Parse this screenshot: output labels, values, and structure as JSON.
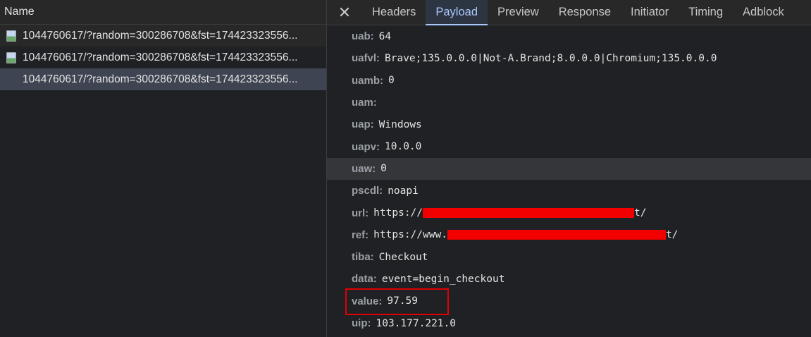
{
  "left_panel": {
    "header": "Name",
    "requests": [
      {
        "name": "1044760617/?random=300286708&fst=174423323556...",
        "icon": "image-file-icon"
      },
      {
        "name": "1044760617/?random=300286708&fst=174423323556...",
        "icon": "image-file-icon"
      },
      {
        "name": "1044760617/?random=300286708&fst=174423323556...",
        "icon": "image-file-icon"
      }
    ]
  },
  "tabs": {
    "close": "✕",
    "items": [
      "Headers",
      "Payload",
      "Preview",
      "Response",
      "Initiator",
      "Timing",
      "Adblock"
    ],
    "active": "Payload"
  },
  "payload": {
    "rows": [
      {
        "key": "uab:",
        "value": "64"
      },
      {
        "key": "uafvl:",
        "value": "Brave;135.0.0.0|Not-A.Brand;8.0.0.0|Chromium;135.0.0.0"
      },
      {
        "key": "uamb:",
        "value": "0"
      },
      {
        "key": "uam:",
        "value": ""
      },
      {
        "key": "uap:",
        "value": "Windows"
      },
      {
        "key": "uapv:",
        "value": "10.0.0"
      },
      {
        "key": "uaw:",
        "value": "0"
      },
      {
        "key": "pscdl:",
        "value": "noapi"
      },
      {
        "key": "url:",
        "value_prefix": "https://",
        "value_suffix": "t/"
      },
      {
        "key": "ref:",
        "value_prefix": "https://www.",
        "value_suffix": "t/"
      },
      {
        "key": "tiba:",
        "value": "Checkout"
      },
      {
        "key": "data:",
        "value": "event=begin_checkout"
      },
      {
        "key": "value:",
        "value": "97.59"
      },
      {
        "key": "uip:",
        "value": "103.177.221.0"
      }
    ]
  },
  "colors": {
    "accent": "#a8c7fa",
    "redaction": "#f20000",
    "annotation_box": "#e00000"
  }
}
